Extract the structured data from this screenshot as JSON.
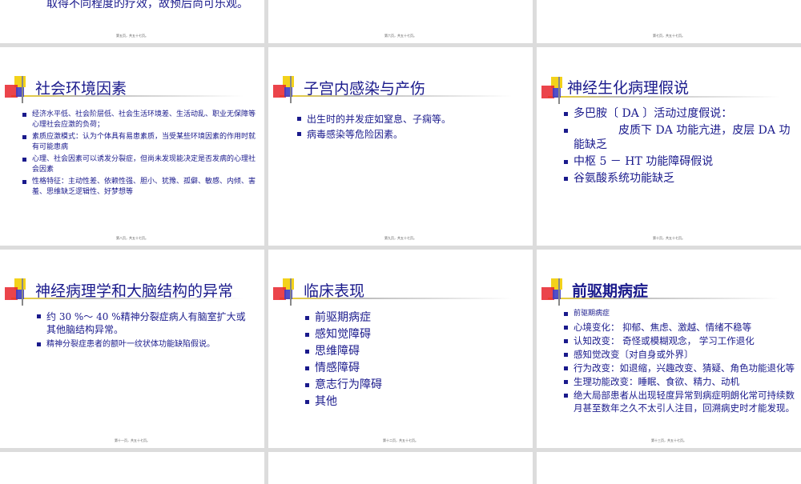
{
  "top_slides": [
    {
      "text": "取得不同程度的疗效，故预后尚可乐观。",
      "footer": "第五页，共五十七页。"
    },
    {
      "text": "",
      "footer": "第六页，共五十七页。"
    },
    {
      "text": "",
      "footer": "第七页，共五十七页。"
    }
  ],
  "slides": [
    {
      "title": "社会环境因素",
      "bold": false,
      "size": "small",
      "bullets": [
        "经济水平低、社会阶层低、社会生活环境差、生活动乱、职业无保障等心理社会应激的负荷；",
        "素质应激模式：认为个体具有易患素质，当受某些环境因素的作用时就有可能患病",
        "心理、社会因素可以诱发分裂症，但尚未发现能决定是否发病的心理社会因素",
        "性格特征：主动性差、依赖性强、胆小、犹豫、孤僻、敏感、内倾、害羞、思维缺乏逻辑性、好梦想等"
      ],
      "footer": "第八页，共五十七页。"
    },
    {
      "title": "子宫内感染与产伤",
      "bold": false,
      "size": "med",
      "bullets": [
        "出生时的并发症如窒息、子痫等。",
        "病毒感染等危险因素。"
      ],
      "footer": "第九页，共五十七页。"
    },
    {
      "title": "神经生化病理假说",
      "bold": false,
      "size": "large",
      "bullets": [
        "多巴胺〔 DA 〕活动过度假说：",
        "　　　　皮质下 DA 功能亢进，皮层 DA 功能缺乏",
        "中枢 5 － HT 功能障碍假说",
        "谷氨酸系统功能缺乏"
      ],
      "footer": "第十页，共五十七页。"
    },
    {
      "title": "神经病理学和大脑结构的异常",
      "bold": false,
      "size": "med",
      "bullets": [
        "约 30 %～ 40 %精神分裂症病人有脑室扩大或其他脑结构异常。",
        "精神分裂症患者的额叶一纹状体功能缺陷假说。"
      ],
      "footer": "第十一页，共五十七页。"
    },
    {
      "title": "临床表现",
      "bold": false,
      "size": "large",
      "bullets": [
        "前驱期病症",
        "感知觉障碍",
        "思维障碍",
        "情感障碍",
        "意志行为障碍",
        "其他"
      ],
      "footer": "第十二页，共五十七页。"
    },
    {
      "title": "前驱期病症",
      "bold": true,
      "size": "mixed",
      "bullets": [
        "前驱期病症",
        "心境变化： 抑郁、焦虑、激越、情绪不稳等",
        "认知改变： 奇怪或模糊观念， 学习工作退化",
        "感知觉改变〔对自身或外界〕",
        "行为改变：如退缩，兴趣改变、猜疑、角色功能退化等",
        "生理功能改变：睡眠、食欲、精力、动机",
        "绝大局部患者从出现轻度异常到病症明朗化常可持续数月甚至数年之久不太引人注目，回溯病史时才能发现。"
      ],
      "tiny_first": true,
      "footer": "第十三页，共五十七页。"
    }
  ]
}
